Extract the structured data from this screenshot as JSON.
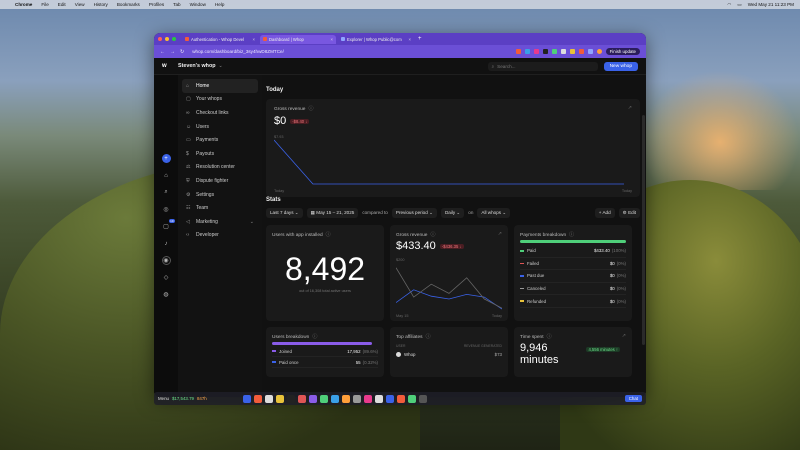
{
  "menubar": {
    "app": "Chrome",
    "items": [
      "File",
      "Edit",
      "View",
      "History",
      "Bookmarks",
      "Profiles",
      "Tab",
      "Window",
      "Help"
    ],
    "datetime": "Wed May 21  11:23 PM"
  },
  "browser": {
    "tabs": [
      {
        "label": "Authentication - Whop Devel",
        "active": false
      },
      {
        "label": "Dashboard | Whop",
        "active": true
      },
      {
        "label": "Explorer | Whop Public@com",
        "active": false
      }
    ],
    "new_tab": "+",
    "url": "whop.com/dashboard/biz_3sy4hwD8ZMTCe/",
    "finish_update": "Finish update"
  },
  "app": {
    "org_name": "Steven's whop",
    "search_placeholder": "Search...",
    "new_whop": "New whop",
    "nav": [
      {
        "label": "Home",
        "icon": "home-icon",
        "active": true
      },
      {
        "label": "Your whops",
        "icon": "box-icon",
        "active": false
      },
      {
        "label": "Checkout links",
        "icon": "link-icon",
        "active": false
      },
      {
        "label": "Users",
        "icon": "users-icon",
        "active": false
      },
      {
        "label": "Payments",
        "icon": "card-icon",
        "active": false
      },
      {
        "label": "Payouts",
        "icon": "payout-icon",
        "active": false
      },
      {
        "label": "Resolution center",
        "icon": "resolution-icon",
        "active": false
      },
      {
        "label": "Dispute fighter",
        "icon": "shield-icon",
        "active": false
      },
      {
        "label": "Settings",
        "icon": "gear-icon",
        "active": false
      },
      {
        "label": "Team",
        "icon": "team-icon",
        "active": false
      },
      {
        "label": "Marketing",
        "icon": "megaphone-icon",
        "active": false
      },
      {
        "label": "Developer",
        "icon": "code-icon",
        "active": false
      }
    ],
    "rail_badge": "19"
  },
  "today": {
    "title": "Today",
    "gross_revenue_label": "Gross revenue",
    "value": "$0",
    "delta": "-$8.40 ↓",
    "y_tick": "$7.93",
    "x_start": "Today",
    "x_end": "Today"
  },
  "stats": {
    "title": "Stats",
    "filters": {
      "range": "Last 7 days",
      "dates": "May 15 – 21, 2025",
      "compared_to": "compared to",
      "previous": "Previous period",
      "granularity": "Daily",
      "on": "on",
      "scope": "All whops",
      "add": "Add",
      "edit": "Edit"
    },
    "users_installed": {
      "label": "Users with app installed",
      "value": "8,492",
      "sub": "out of 16,308 total active users"
    },
    "gross_revenue": {
      "label": "Gross revenue",
      "value": "$433.40",
      "delta": "-$436.35 ↓",
      "y_tick": "$200",
      "x_start": "May 15",
      "x_end": "Today"
    },
    "payments_breakdown": {
      "label": "Payments breakdown",
      "rows": [
        {
          "label": "Paid",
          "value": "$433.40",
          "pct": "(100%)",
          "color": "#4fcf7a"
        },
        {
          "label": "Failed",
          "value": "$0",
          "pct": "(0%)",
          "color": "#e05555"
        },
        {
          "label": "Past due",
          "value": "$0",
          "pct": "(0%)",
          "color": "#3a62e8"
        },
        {
          "label": "Canceled",
          "value": "$0",
          "pct": "(0%)",
          "color": "#999999"
        },
        {
          "label": "Refunded",
          "value": "$0",
          "pct": "(0%)",
          "color": "#e8c23a"
        }
      ]
    },
    "users_breakdown": {
      "label": "Users breakdown",
      "rows": [
        {
          "label": "Joined",
          "value": "17,952",
          "pct": "(89.6%)"
        },
        {
          "label": "Paid once",
          "value": "55",
          "pct": "(0.32%)"
        }
      ]
    },
    "top_affiliates": {
      "label": "Top affiliates",
      "col_user": "USER",
      "col_rev": "REVENUE GENERATED",
      "rows": [
        {
          "name": "Whop",
          "value": "$73"
        }
      ]
    },
    "time_spent": {
      "label": "Time spent",
      "value": "9,946",
      "unit": "minutes",
      "delta": "4,556 minutes ↑"
    }
  },
  "chart_data": [
    {
      "type": "line",
      "title": "Gross revenue",
      "x": [
        "Today",
        "Today"
      ],
      "series": [
        {
          "name": "Gross revenue",
          "values": [
            7.93,
            0,
            0,
            0,
            0,
            0,
            0,
            0,
            0,
            0
          ]
        }
      ],
      "ylim": [
        0,
        7.93
      ]
    },
    {
      "type": "line",
      "title": "Gross revenue",
      "x": [
        "May 15",
        "May 16",
        "May 17",
        "May 18",
        "May 19",
        "May 20",
        "Today"
      ],
      "series": [
        {
          "name": "Current",
          "values": [
            40,
            110,
            75,
            60,
            85,
            70,
            5
          ]
        },
        {
          "name": "Previous",
          "values": [
            230,
            70,
            140,
            90,
            175,
            60,
            10
          ]
        }
      ],
      "ylim": [
        0,
        250
      ]
    }
  ],
  "dock": {
    "items": [
      "Menu",
      "$17,543.79",
      "847h"
    ],
    "chat": "Chat"
  }
}
